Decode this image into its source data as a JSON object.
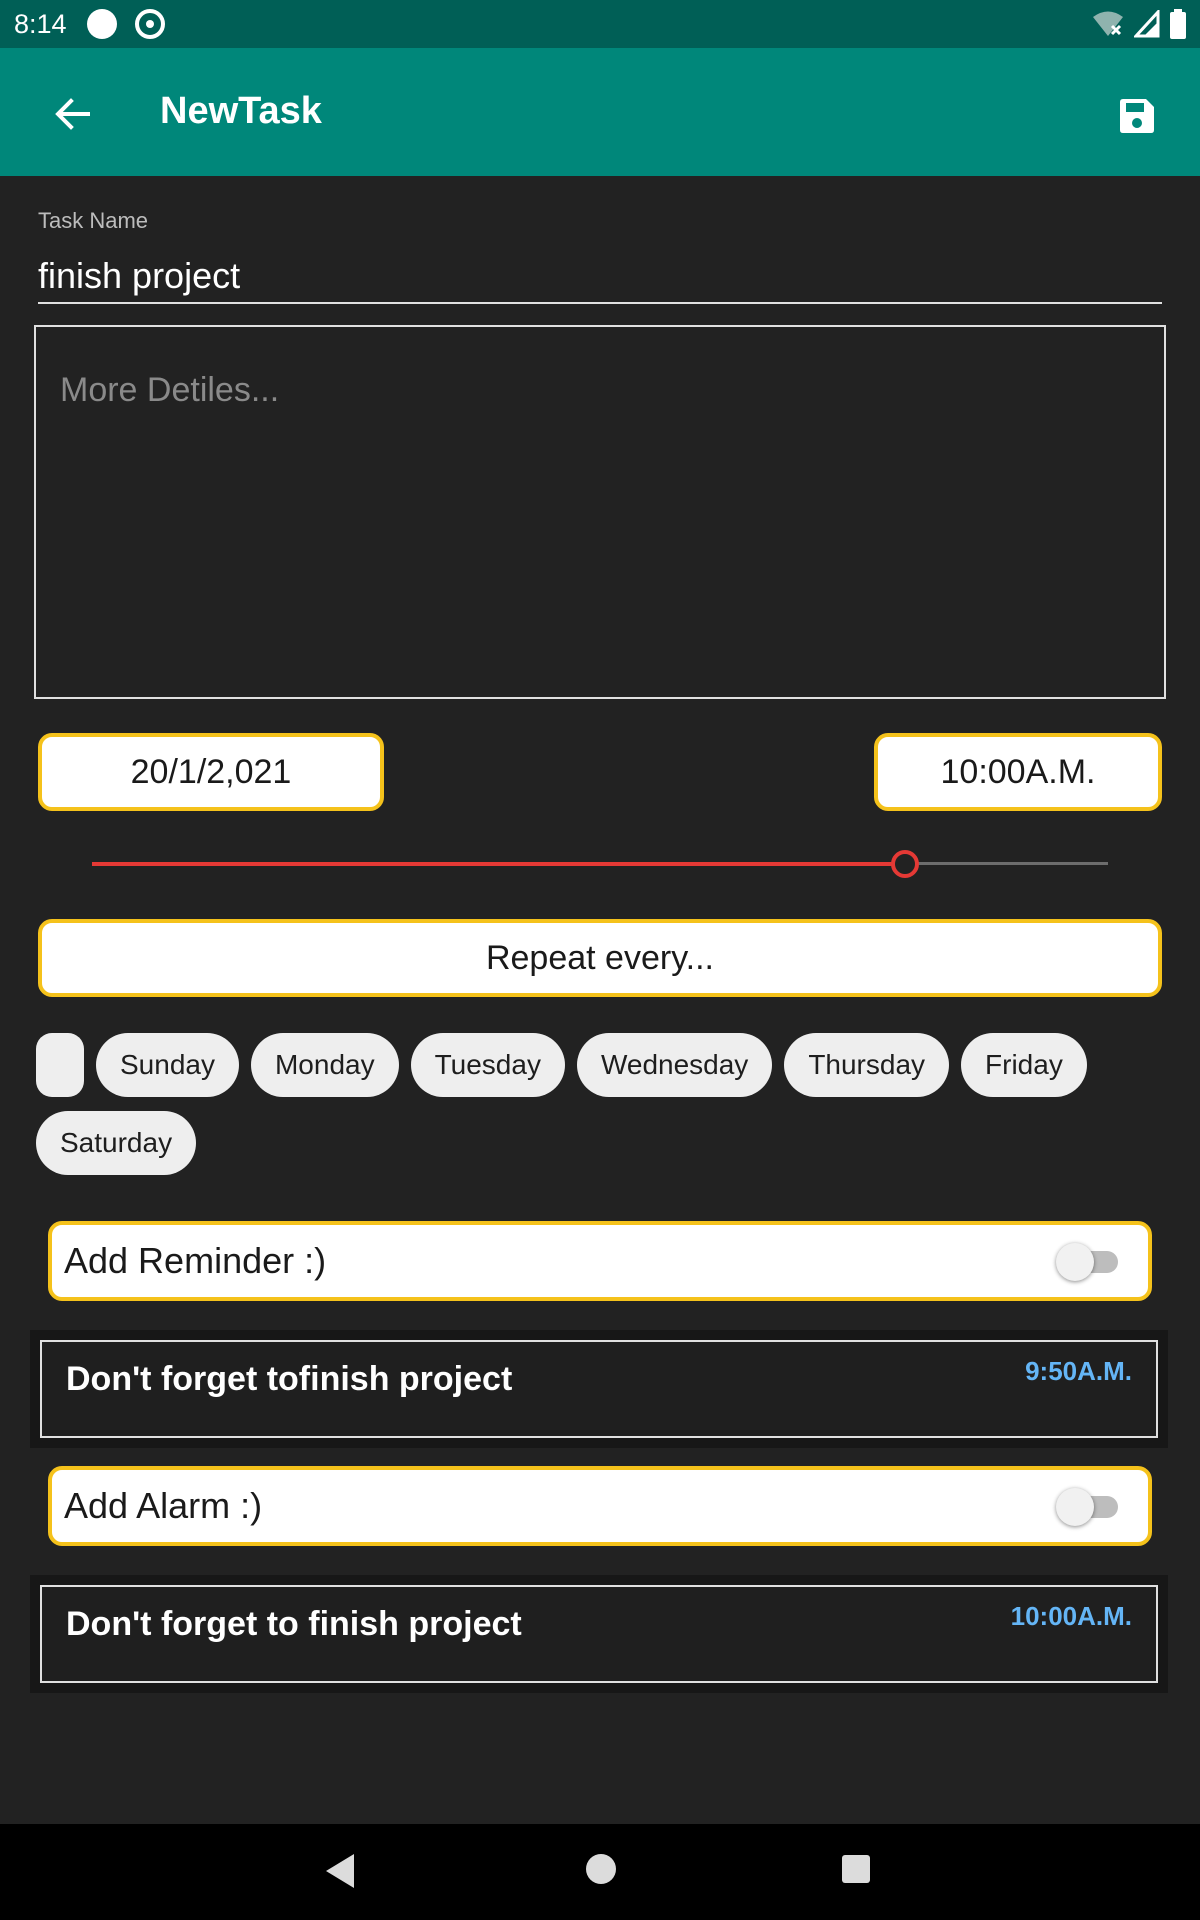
{
  "status_bar": {
    "time": "8:14"
  },
  "app_bar": {
    "title": "NewTask"
  },
  "task_name": {
    "label": "Task Name",
    "value": "finish project"
  },
  "details": {
    "placeholder": "More Detiles..."
  },
  "date_button": {
    "label": "20/1/2,021"
  },
  "time_button": {
    "label": "10:00A.M."
  },
  "priority_slider": {
    "value": 0.8
  },
  "repeat_button": {
    "label": "Repeat every..."
  },
  "days": [
    "Sunday",
    "Monday",
    "Tuesday",
    "Wednesday",
    "Thursday",
    "Friday",
    "Saturday"
  ],
  "reminder": {
    "label": "Add Reminder :)",
    "enabled": false
  },
  "reminder_note": {
    "text": "Don't forget tofinish project",
    "time": "9:50A.M."
  },
  "alarm": {
    "label": "Add Alarm :)",
    "enabled": false
  },
  "alarm_note": {
    "text": "Don't forget to finish project",
    "time": "10:00A.M."
  },
  "colors": {
    "primary": "#00877a",
    "primary_dark": "#005f56",
    "accent_border": "#f5c21b",
    "slider": "#e53935",
    "note_time": "#64b5f6"
  }
}
